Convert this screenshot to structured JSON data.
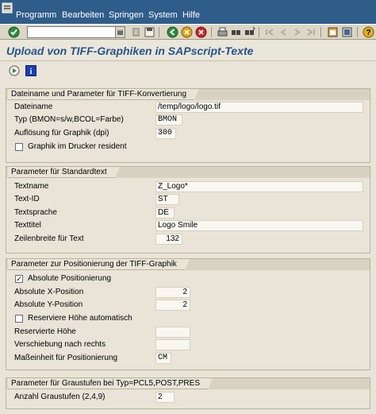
{
  "menu": {
    "items": [
      "Programm",
      "Bearbeiten",
      "Springen",
      "System",
      "Hilfe"
    ]
  },
  "toolbar": {
    "command_field_value": ""
  },
  "screen": {
    "title": "Upload von TIFF-Graphiken in SAPscript-Texte"
  },
  "frame_file": {
    "title": "Dateiname und Parameter für TIFF-Konvertierung",
    "filename_label": "Dateiname",
    "filename_value": "/temp/logo/logo.tif",
    "type_label": "Typ (BMON=s/w,BCOL=Farbe)",
    "type_value": "BMON",
    "resolution_label": "Auflösung für Graphik (dpi)",
    "resolution_value": "300",
    "resident_label": "Graphik im Drucker resident",
    "resident_checked": false
  },
  "frame_text": {
    "title": "Parameter für Standardtext",
    "textname_label": "Textname",
    "textname_value": "Z_Logo*",
    "textid_label": "Text-ID",
    "textid_value": "ST",
    "language_label": "Textsprache",
    "language_value": "DE",
    "texttitle_label": "Texttitel",
    "texttitle_value": "Logo Smile",
    "linewidth_label": "Zeilenbreite für Text",
    "linewidth_value": "132"
  },
  "frame_pos": {
    "title": "Parameter zur Positionierung der TIFF-Graphik",
    "absolute_label": "Absolute Positionierung",
    "absolute_checked": true,
    "xpos_label": "Absolute X-Position",
    "xpos_value": "2",
    "ypos_label": "Absolute Y-Position",
    "ypos_value": "2",
    "reserve_auto_label": "Reserviere Höhe automatisch",
    "reserve_auto_checked": false,
    "reserved_height_label": "Reservierte Höhe",
    "reserved_height_value": "",
    "shift_right_label": "Verschiebung nach rechts",
    "shift_right_value": "",
    "unit_label": "Maßeinheit für Positionierung",
    "unit_value": "CM"
  },
  "frame_gray": {
    "title": "Parameter für Graustufen bei Typ=PCL5,POST,PRES",
    "count_label": "Anzahl Graustufen (2,4,9)",
    "count_value": "2"
  },
  "colors": {
    "menubar": "#2f5d8a",
    "title": "#27558b",
    "background": "#e9e4d7",
    "field": "#f9f7f0"
  }
}
